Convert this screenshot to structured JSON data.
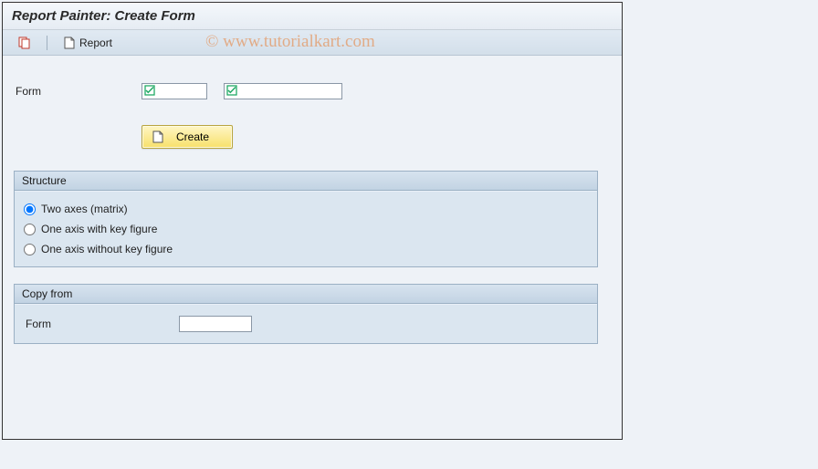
{
  "title": "Report Painter: Create Form",
  "toolbar": {
    "copy_tooltip": "Copy",
    "report_label": "Report"
  },
  "watermark": "© www.tutorialkart.com",
  "form": {
    "label": "Form",
    "code_value": "",
    "desc_value": ""
  },
  "create_button": "Create",
  "structure": {
    "title": "Structure",
    "options": [
      {
        "label": "Two axes (matrix)",
        "selected": true
      },
      {
        "label": "One axis with key figure",
        "selected": false
      },
      {
        "label": "One axis without key figure",
        "selected": false
      }
    ]
  },
  "copyfrom": {
    "title": "Copy from",
    "label": "Form",
    "value": ""
  }
}
